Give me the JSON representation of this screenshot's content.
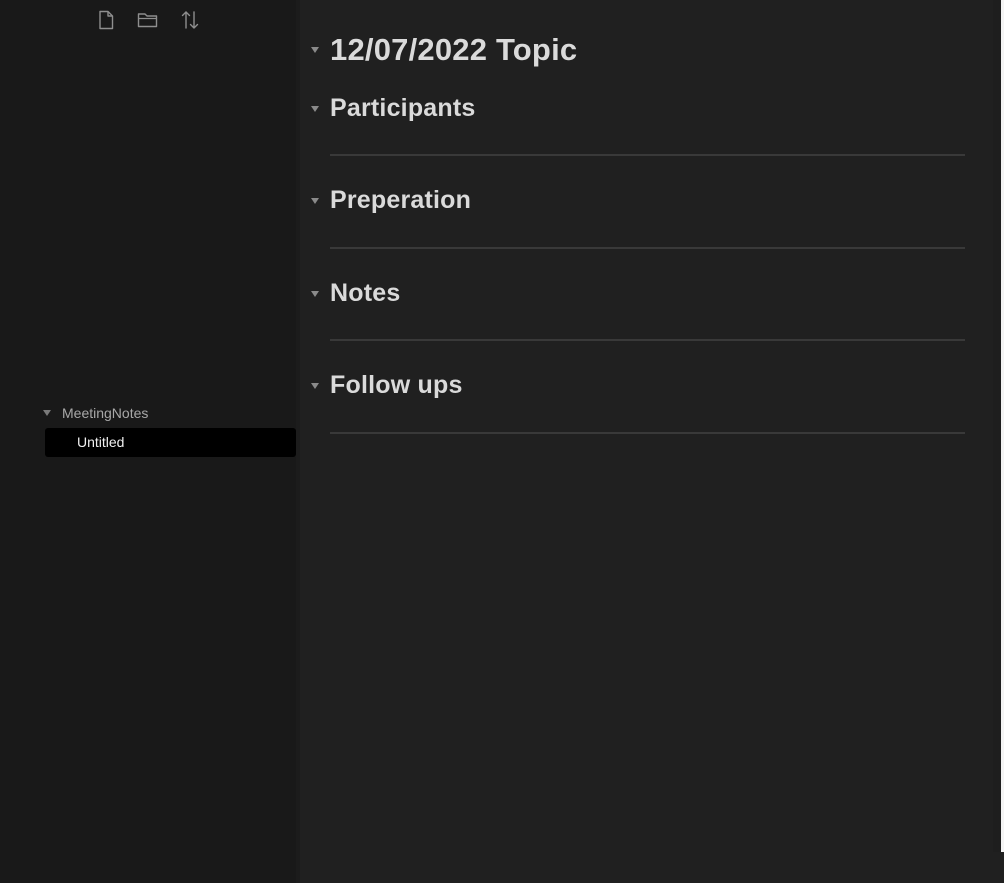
{
  "sidebar": {
    "toolbar": {
      "new_note_icon": "new-note-icon",
      "new_folder_icon": "new-folder-icon",
      "sort_icon": "sort-icon"
    },
    "tree": {
      "folder": {
        "label": "MeetingNotes",
        "expanded": true,
        "files": [
          {
            "label": "Untitled",
            "active": true
          }
        ]
      }
    }
  },
  "editor": {
    "title": "12/07/2022 Topic",
    "sections": [
      {
        "label": "Participants"
      },
      {
        "label": "Preperation"
      },
      {
        "label": "Notes"
      },
      {
        "label": "Follow ups"
      }
    ]
  },
  "colors": {
    "sidebar_bg": "#191919",
    "editor_bg": "#202020",
    "active_file_bg": "#000000",
    "heading_text": "#dadada",
    "rule": "#393939"
  }
}
